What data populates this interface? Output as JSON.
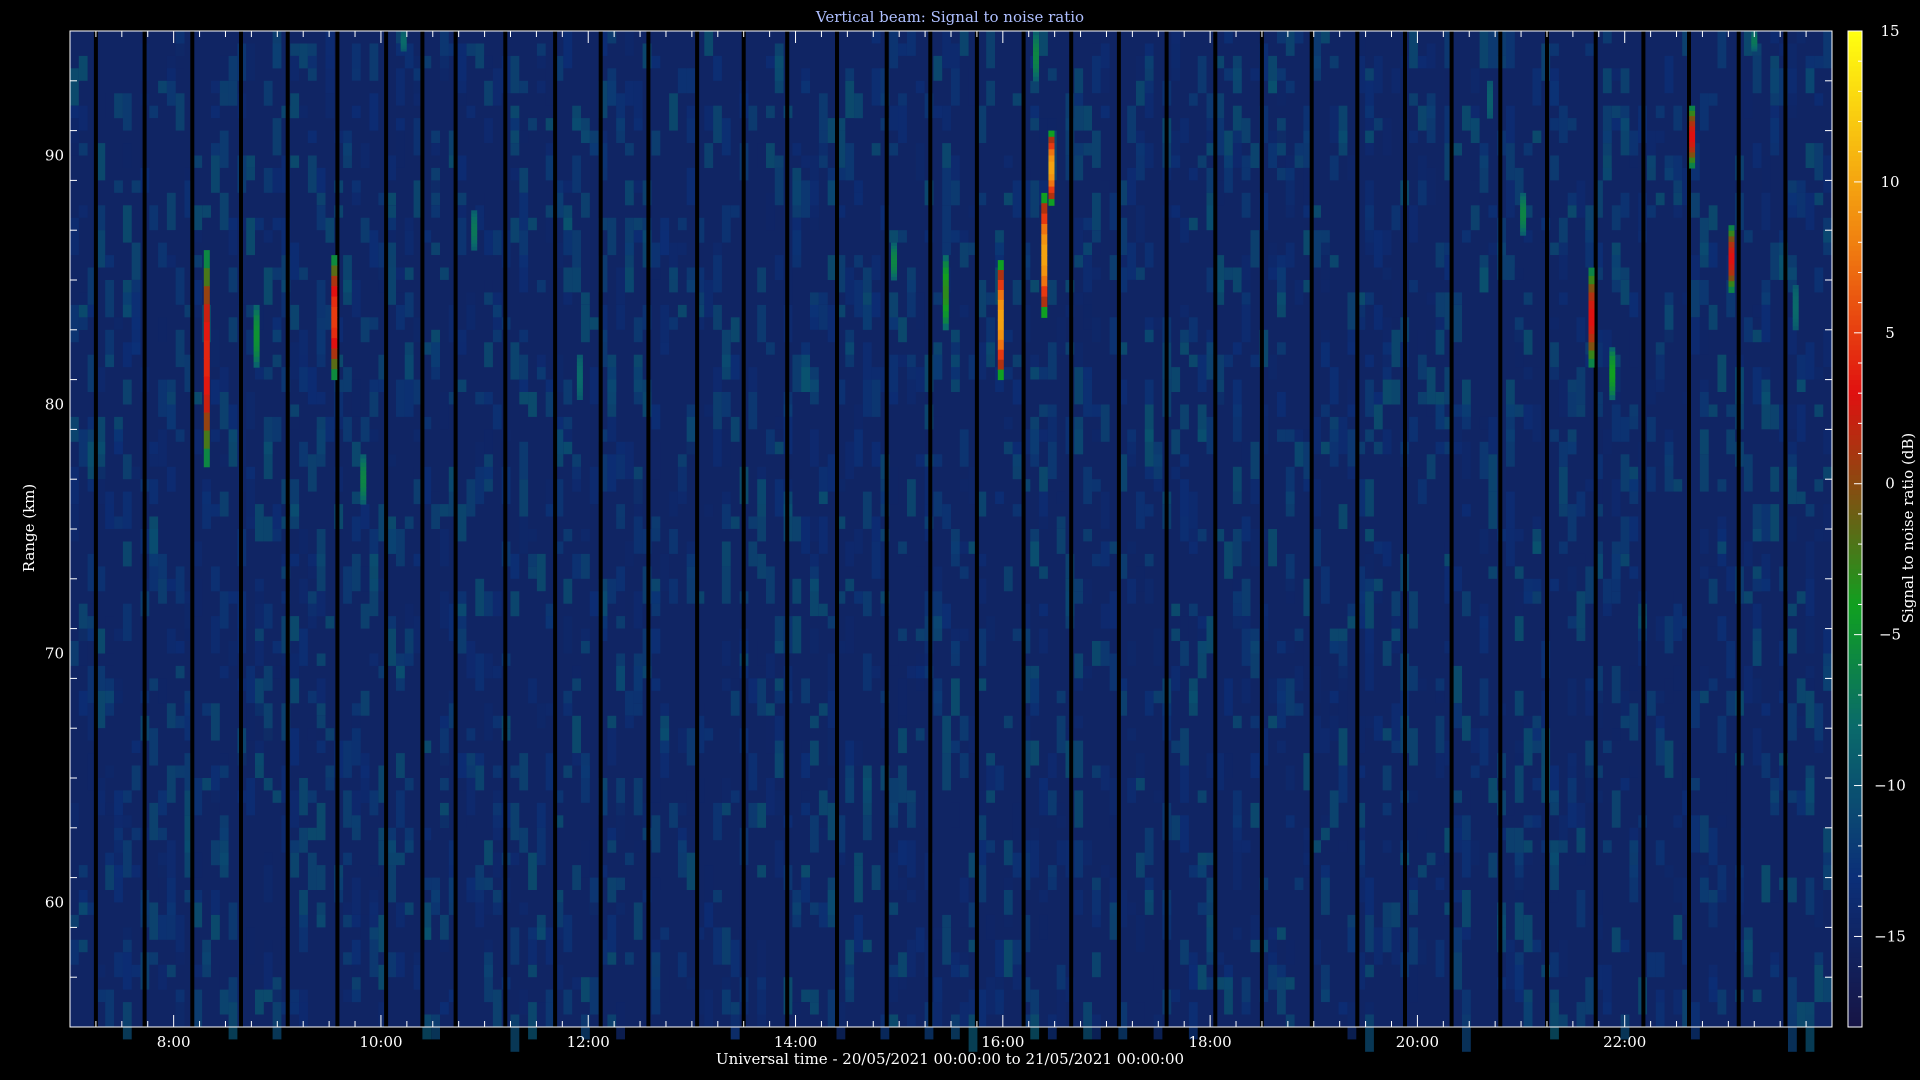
{
  "chart_data": {
    "type": "heatmap",
    "title": "Vertical beam: Signal to noise ratio",
    "xlabel": "Universal time - 20/05/2021 00:00:00 to 21/05/2021 00:00:00",
    "ylabel": "Range (km)",
    "colorbar_label": "Signal to noise ratio (dB)",
    "xlim_hours": [
      7.0,
      24.0
    ],
    "ylim_km": [
      55,
      95
    ],
    "x_ticks": [
      {
        "value": 8,
        "label": "8:00"
      },
      {
        "value": 10,
        "label": "10:00"
      },
      {
        "value": 12,
        "label": "12:00"
      },
      {
        "value": 14,
        "label": "14:00"
      },
      {
        "value": 16,
        "label": "16:00"
      },
      {
        "value": 18,
        "label": "18:00"
      },
      {
        "value": 20,
        "label": "20:00"
      },
      {
        "value": 22,
        "label": "22:00"
      }
    ],
    "y_ticks": [
      {
        "value": 60,
        "label": "60"
      },
      {
        "value": 70,
        "label": "70"
      },
      {
        "value": 80,
        "label": "80"
      },
      {
        "value": 90,
        "label": "90"
      }
    ],
    "colorbar": {
      "range": [
        -18,
        15
      ],
      "ticks": [
        {
          "value": 15,
          "label": "15"
        },
        {
          "value": 10,
          "label": "10"
        },
        {
          "value": 5,
          "label": "5"
        },
        {
          "value": 0,
          "label": "0"
        },
        {
          "value": -5,
          "label": "−5"
        },
        {
          "value": -10,
          "label": "−10"
        },
        {
          "value": -15,
          "label": "−15"
        }
      ],
      "color_stops": [
        {
          "value": -18,
          "color": "#171545"
        },
        {
          "value": -13,
          "color": "#0b2f78"
        },
        {
          "value": -8,
          "color": "#0a6a6a"
        },
        {
          "value": -4,
          "color": "#10a020"
        },
        {
          "value": 0,
          "color": "#8a4a10"
        },
        {
          "value": 3,
          "color": "#e01010"
        },
        {
          "value": 8,
          "color": "#f08010"
        },
        {
          "value": 15,
          "color": "#ffff10"
        }
      ]
    },
    "background_snr_db": -15,
    "data_gap_times_hours": [
      7.25,
      7.72,
      8.18,
      8.65,
      9.1,
      9.58,
      10.05,
      10.4,
      10.72,
      11.2,
      11.68,
      12.12,
      12.58,
      13.05,
      13.5,
      13.92,
      14.4,
      14.88,
      15.3,
      15.75,
      16.2,
      16.66,
      17.12,
      17.58,
      18.05,
      18.5,
      18.98,
      19.42,
      19.88,
      20.33,
      20.8,
      21.25,
      21.72,
      22.18,
      22.62,
      23.1,
      23.55
    ],
    "echoes": [
      {
        "time": 8.32,
        "range_bottom": 77.5,
        "range_top": 86.2,
        "peak_snr": 4
      },
      {
        "time": 8.8,
        "range_bottom": 81.5,
        "range_top": 84.0,
        "peak_snr": -5
      },
      {
        "time": 9.55,
        "range_bottom": 81.0,
        "range_top": 86.0,
        "peak_snr": 5
      },
      {
        "time": 9.83,
        "range_bottom": 76.0,
        "range_top": 78.0,
        "peak_snr": -6
      },
      {
        "time": 10.22,
        "range_bottom": 94.2,
        "range_top": 95.0,
        "peak_snr": -8
      },
      {
        "time": 10.9,
        "range_bottom": 86.2,
        "range_top": 87.8,
        "peak_snr": -7
      },
      {
        "time": 11.92,
        "range_bottom": 80.2,
        "range_top": 82.0,
        "peak_snr": -8
      },
      {
        "time": 14.95,
        "range_bottom": 85.0,
        "range_top": 86.5,
        "peak_snr": -6
      },
      {
        "time": 15.45,
        "range_bottom": 83.0,
        "range_top": 86.0,
        "peak_snr": -3
      },
      {
        "time": 15.98,
        "range_bottom": 81.0,
        "range_top": 85.8,
        "peak_snr": 10
      },
      {
        "time": 16.32,
        "range_bottom": 93.0,
        "range_top": 95.0,
        "peak_snr": -6
      },
      {
        "time": 16.4,
        "range_bottom": 83.5,
        "range_top": 88.5,
        "peak_snr": 10
      },
      {
        "time": 16.47,
        "range_bottom": 88.0,
        "range_top": 91.0,
        "peak_snr": 10
      },
      {
        "time": 20.7,
        "range_bottom": 91.5,
        "range_top": 93.0,
        "peak_snr": -9
      },
      {
        "time": 21.02,
        "range_bottom": 86.8,
        "range_top": 88.5,
        "peak_snr": -6
      },
      {
        "time": 21.68,
        "range_bottom": 81.5,
        "range_top": 85.5,
        "peak_snr": 3
      },
      {
        "time": 21.88,
        "range_bottom": 80.2,
        "range_top": 82.3,
        "peak_snr": -4
      },
      {
        "time": 22.65,
        "range_bottom": 89.5,
        "range_top": 92.0,
        "peak_snr": 3
      },
      {
        "time": 23.03,
        "range_bottom": 84.5,
        "range_top": 87.2,
        "peak_snr": 3
      },
      {
        "time": 23.25,
        "range_bottom": 94.2,
        "range_top": 95.0,
        "peak_snr": -7
      },
      {
        "time": 23.65,
        "range_bottom": 83.0,
        "range_top": 84.8,
        "peak_snr": -8
      }
    ]
  }
}
